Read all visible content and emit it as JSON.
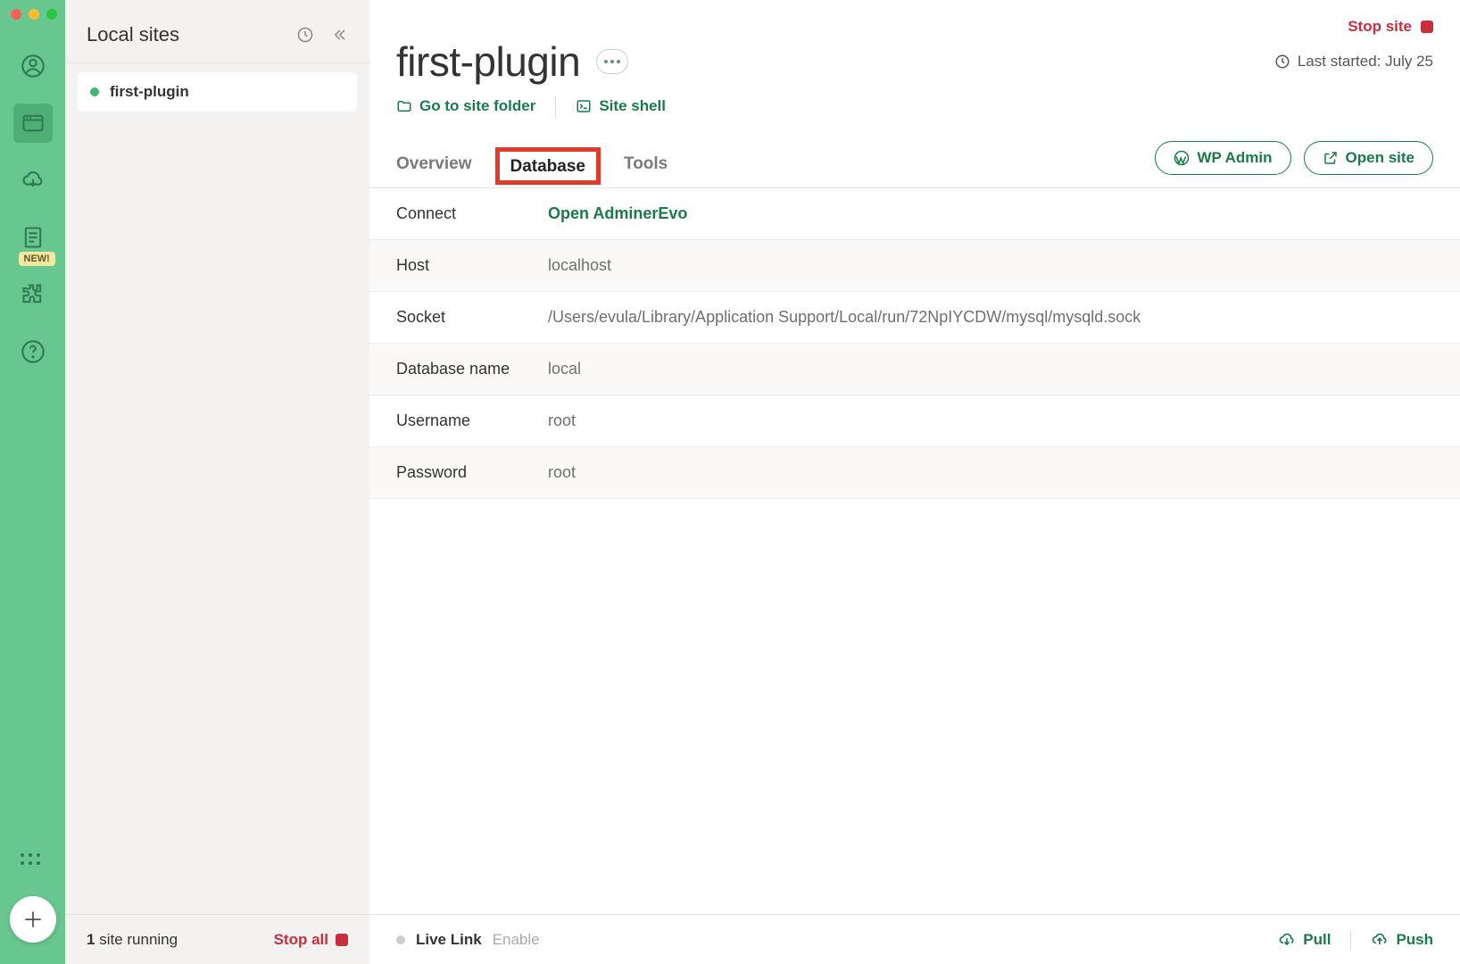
{
  "sidebar": {
    "title": "Local sites",
    "new_badge": "NEW!",
    "sites": [
      {
        "name": "first-plugin",
        "status": "running"
      }
    ],
    "footer": {
      "count": "1",
      "running_label": " site running",
      "stop_all": "Stop all"
    }
  },
  "main": {
    "stop_site": "Stop site",
    "site_name": "first-plugin",
    "last_started_label": "Last started: ",
    "last_started_value": "July 25",
    "links": {
      "folder": "Go to site folder",
      "shell": "Site shell"
    },
    "tabs": [
      {
        "id": "overview",
        "label": "Overview",
        "active": false
      },
      {
        "id": "database",
        "label": "Database",
        "active": true
      },
      {
        "id": "tools",
        "label": "Tools",
        "active": false
      }
    ],
    "actions": {
      "wp_admin": "WP Admin",
      "open_site": "Open site"
    },
    "details": [
      {
        "label": "Connect",
        "value": "Open AdminerEvo",
        "link": true
      },
      {
        "label": "Host",
        "value": "localhost"
      },
      {
        "label": "Socket",
        "value": "/Users/evula/Library/Application Support/Local/run/72NpIYCDW/mysql/mysqld.sock"
      },
      {
        "label": "Database name",
        "value": "local"
      },
      {
        "label": "Username",
        "value": "root"
      },
      {
        "label": "Password",
        "value": "root"
      }
    ],
    "footer": {
      "live_link": "Live Link",
      "enable": "Enable",
      "pull": "Pull",
      "push": "Push"
    }
  }
}
